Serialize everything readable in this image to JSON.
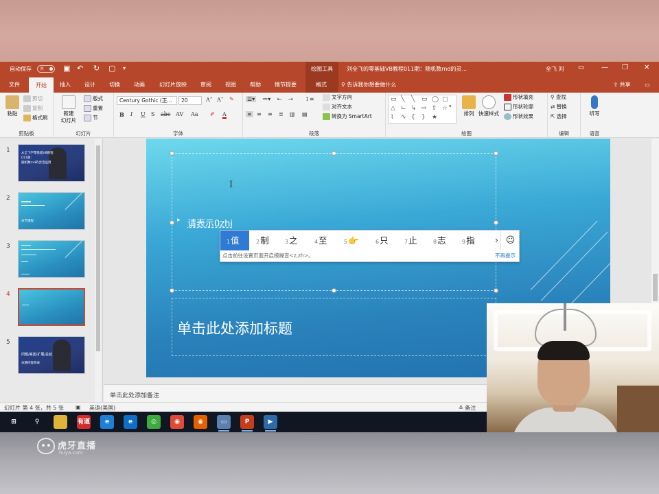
{
  "titlebar": {
    "autosave_label": "自动保存",
    "autosave_state": "关",
    "drawing_tools_label": "绘图工具",
    "document_title": "刘全飞的零基础VB教程011期：随机数rnd的灵...",
    "user_name": "全飞 刘",
    "colors": {
      "ribbon": "#b7472a",
      "context_tab": "#9b3a21"
    }
  },
  "tabs": [
    "文件",
    "开始",
    "插入",
    "设计",
    "切换",
    "动画",
    "幻灯片放映",
    "审阅",
    "视图",
    "帮助",
    "情节提要",
    "格式"
  ],
  "tell_me": "告诉我你想要做什么",
  "share": "共享",
  "ribbon": {
    "clipboard": {
      "paste": "粘贴",
      "cut": "剪切",
      "copy": "复制",
      "format_painter": "格式刷",
      "label": "剪贴板"
    },
    "slides": {
      "new_slide": "新建",
      "new_slide_2": "幻灯片",
      "layout": "版式",
      "reset": "重置",
      "section": "节",
      "label": "幻灯片"
    },
    "font": {
      "font_name": "Century Gothic (正...",
      "font_size": "20",
      "label": "字体",
      "buttons": [
        "B",
        "I",
        "U",
        "S",
        "abc",
        "AV",
        "Aa",
        "A"
      ]
    },
    "paragraph": {
      "text_direction": "文字方向",
      "align_text": "对齐文本",
      "smartart": "转换为 SmartArt",
      "label": "段落"
    },
    "drawing": {
      "arrange": "排列",
      "quick_styles": "快速样式",
      "fill": "形状填充",
      "outline": "形状轮廓",
      "effects": "形状效果",
      "label": "绘图"
    },
    "editing": {
      "find": "查找",
      "replace": "替换",
      "select": "选择",
      "label": "编辑"
    },
    "voice": {
      "dictate": "听写",
      "label": "语音"
    }
  },
  "thumbnails": [
    {
      "num": "1",
      "lines": [
        "从全飞学零基础VB教程",
        "011期：",
        "随机数rnd的灵活运用"
      ],
      "style": "dark",
      "active": false
    },
    {
      "num": "2",
      "lines": [
        "",
        "",
        "本节课程"
      ],
      "style": "light",
      "active": false
    },
    {
      "num": "3",
      "lines": [
        "",
        "",
        ""
      ],
      "style": "light",
      "active": false
    },
    {
      "num": "4",
      "lines": [
        ""
      ],
      "style": "light",
      "active": true
    },
    {
      "num": "5",
      "lines": [
        "问题/答案/扩展/总结",
        "",
        "本期内容目录"
      ],
      "style": "dark",
      "active": false
    }
  ],
  "slide": {
    "composition_text": "请表示0zhi",
    "title_placeholder": "单击此处添加标题"
  },
  "ime": {
    "candidates": [
      {
        "n": "1",
        "w": "值"
      },
      {
        "n": "2",
        "w": "制"
      },
      {
        "n": "3",
        "w": "之"
      },
      {
        "n": "4",
        "w": "至"
      },
      {
        "n": "5",
        "w": "👉"
      },
      {
        "n": "6",
        "w": "只"
      },
      {
        "n": "7",
        "w": "止"
      },
      {
        "n": "8",
        "w": "志"
      },
      {
        "n": "9",
        "w": "指"
      }
    ],
    "next_arrow": "›",
    "emoji_button": "☺",
    "hint": "点击前往设置页面开启模糊音<z,zh>。",
    "dismiss": "不再提示",
    "selected_color": "#2f7bd3"
  },
  "notes_placeholder": "单击此处添加备注",
  "status": {
    "slide_info": "幻灯片 第 4 张，共 5 张",
    "language": "英语(美国)",
    "notes_button": "备注"
  },
  "taskbar": {
    "items": [
      {
        "name": "windows-start-icon",
        "label": "⊞",
        "color": "#101722",
        "open": false
      },
      {
        "name": "search-icon",
        "label": "⚲",
        "color": "#101722",
        "open": false
      },
      {
        "name": "file-explorer-icon",
        "label": "",
        "color": "#e0b33a",
        "open": false
      },
      {
        "name": "youdao-icon",
        "label": "有道",
        "color": "#d42b2b",
        "open": false
      },
      {
        "name": "ie-icon",
        "label": "e",
        "color": "#1e7fd6",
        "open": false
      },
      {
        "name": "edge-icon",
        "label": "e",
        "color": "#0f6fc6",
        "open": false
      },
      {
        "name": "360-icon",
        "label": "◎",
        "color": "#3caa3c",
        "open": false
      },
      {
        "name": "chrome-icon",
        "label": "◉",
        "color": "#dd4b39",
        "open": false
      },
      {
        "name": "firefox-icon",
        "label": "◉",
        "color": "#e66000",
        "open": false
      },
      {
        "name": "vb6-icon",
        "label": "▭",
        "color": "#5b7fae",
        "open": true
      },
      {
        "name": "powerpoint-icon",
        "label": "P",
        "color": "#c43e1c",
        "open": true
      },
      {
        "name": "screen-recorder-icon",
        "label": "▶",
        "color": "#2d6aa8",
        "open": true
      }
    ]
  },
  "watermark": {
    "name": "虎牙直播",
    "url": "huya.com"
  }
}
